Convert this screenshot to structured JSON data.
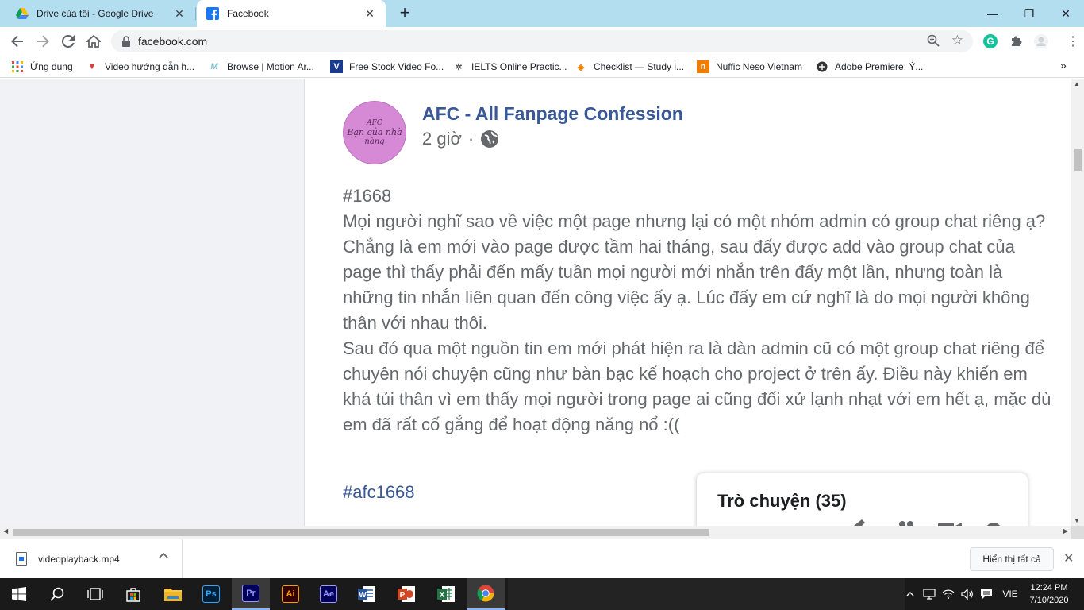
{
  "browser": {
    "tabs": [
      {
        "title": "Drive của tôi - Google Drive",
        "active": false,
        "favicon": "google-drive-icon"
      },
      {
        "title": "Facebook",
        "active": true,
        "favicon": "facebook-icon"
      }
    ],
    "tab_close": "✕",
    "new_tab": "+",
    "window_controls": {
      "minimize": "—",
      "maximize": "❐",
      "close": "✕"
    },
    "address": "facebook.com",
    "bookmarks": [
      {
        "label": "Ứng dụng",
        "icon": "apps-grid-icon"
      },
      {
        "label": "Video hướng dẫn h...",
        "icon": "video-tutorial-icon"
      },
      {
        "label": "Browse | Motion Ar...",
        "icon": "motion-array-icon"
      },
      {
        "label": "Free Stock Video Fo...",
        "icon": "videvo-icon"
      },
      {
        "label": "IELTS Online Practic...",
        "icon": "ielts-icon"
      },
      {
        "label": "Checklist — Study i...",
        "icon": "checklist-icon"
      },
      {
        "label": "Nuffic Neso Vietnam",
        "icon": "nuffic-icon"
      },
      {
        "label": "Adobe Premiere: Ý...",
        "icon": "adobe-premiere-bookmark-icon"
      }
    ],
    "bookmarks_more": "»"
  },
  "post": {
    "page_name": "AFC - All Fanpage Confession",
    "time": "2 giờ",
    "separator": "·",
    "privacy_icon": "globe-icon",
    "avatar_lines": [
      "AFC",
      "Bạn của nhà",
      "nàng"
    ],
    "paragraphs": [
      "#1668",
      "Mọi người nghĩ sao về việc một page nhưng lại có một nhóm admin có group chat riêng ạ?",
      "Chẳng là em mới vào page được tầm hai tháng, sau đấy được add vào group chat của page thì thấy phải đến mấy tuần mọi người mới nhắn trên đấy một lần, nhưng toàn là những tin nhắn liên quan đến công việc ấy ạ. Lúc đấy em cứ nghĩ là do mọi người không thân với nhau thôi.",
      "Sau đó qua một nguồn tin em mới phát hiện ra là dàn admin cũ có một group chat riêng để chuyên nói chuyện cũng như bàn bạc kế hoạch cho project ở trên ấy. Điều này khiến em khá tủi thân vì em thấy mọi người trong page ai cũng đối xử lạnh nhạt với em hết ạ, mặc dù em đã rất cố gắng để hoạt động năng nổ :(("
    ],
    "hashtag": "#afc1668"
  },
  "chat": {
    "title": "Trò chuyện (35)"
  },
  "downloads": {
    "file_name": "videoplayback.mp4",
    "show_all": "Hiển thị tất cả",
    "close": "✕"
  },
  "taskbar": {
    "apps": [
      {
        "name": "Ps",
        "color": "#31a8ff",
        "bg": "#001e36"
      },
      {
        "name": "Pr",
        "color": "#9999ff",
        "bg": "#00005b"
      },
      {
        "name": "Ai",
        "color": "#ff9a00",
        "bg": "#330000"
      },
      {
        "name": "Ae",
        "color": "#9999ff",
        "bg": "#00005b"
      }
    ],
    "language": "VIE",
    "time": "12:24 PM",
    "date": "7/10/2020"
  },
  "colors": {
    "tabstrip": "#b3def0",
    "facebook_blue": "#385898",
    "page_bg": "#f0f2f5"
  }
}
